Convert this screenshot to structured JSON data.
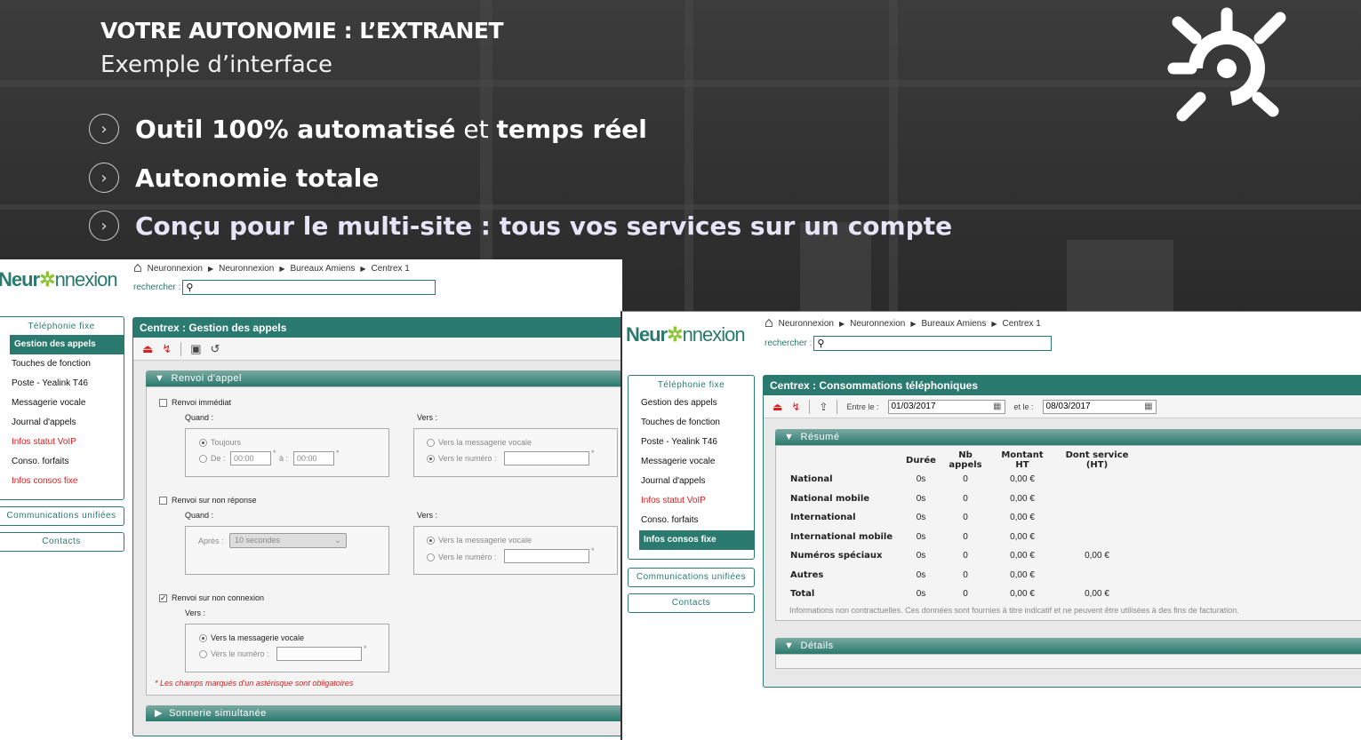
{
  "slide": {
    "title": "VOTRE AUTONOMIE : L’EXTRANET",
    "subtitle": "Exemple d’interface",
    "bullets": [
      {
        "bold1": "Outil 100% automatisé",
        "normal": " et ",
        "bold2": "temps réel"
      },
      {
        "bold1": "Autonomie totale",
        "normal": "",
        "bold2": ""
      },
      {
        "bold1": "Conçu pour le multi-site : tous vos services sur un compte",
        "normal": "",
        "bold2": ""
      }
    ],
    "bullet_icon": "chevron-right-circle-icon",
    "brand_icon": "neuronnexion-sun-icon"
  },
  "colors": {
    "accent": "#2a7a6f",
    "alert": "#d52020",
    "brand_green": "#8fc33a"
  },
  "brand": {
    "part1": "Neur",
    "part2": "nnexion"
  },
  "screen1": {
    "breadcrumb": [
      "Neuronnexion",
      "Neuronnexion",
      "Bureaux Amiens",
      "Centrex 1"
    ],
    "search_label": "rechercher :",
    "logout": "deconnexion",
    "sidebar_title": "Téléphonie fixe",
    "sidebar_items": [
      "Gestion des appels",
      "Touches de fonction",
      "Poste - Yealink T46",
      "Messagerie vocale",
      "Journal d'appels",
      "Infos statut VoIP",
      "Conso. forfaits",
      "Infos consos fixe"
    ],
    "btn_comm": "Communications unifiées",
    "btn_contacts": "Contacts",
    "panel_title": "Centrex : Gestion des appels",
    "sec_renvoi": "Renvoi d'appel",
    "renvoi_immediat": "Renvoi immédiat",
    "quand": "Quand :",
    "vers": "Vers :",
    "toujours": "Toujours",
    "de": "De :",
    "a": "à :",
    "time1": "00:00",
    "time2": "00:00",
    "vers_messagerie": "Vers la messagerie vocale",
    "vers_numero": "Vers le numéro :",
    "renvoi_non_reponse": "Renvoi sur non réponse",
    "apres": "Après :",
    "apres_value": "10 secondes",
    "renvoi_non_connexion": "Renvoi sur non connexion",
    "required_note": "* Les champs marqués d'un astérisque sont obligatoires",
    "star": "*",
    "sec_sonnerie": "Sonnerie simultanée"
  },
  "screen2": {
    "breadcrumb": [
      "Neuronnexion",
      "Neuronnexion",
      "Bureaux Amiens",
      "Centrex 1"
    ],
    "search_label": "rechercher :",
    "sidebar_title": "Téléphonie fixe",
    "sidebar_items": [
      "Gestion des appels",
      "Touches de fonction",
      "Poste - Yealink T46",
      "Messagerie vocale",
      "Journal d'appels",
      "Infos statut VoIP",
      "Conso. forfaits",
      "Infos consos fixe"
    ],
    "btn_comm": "Communications unifiées",
    "btn_contacts": "Contacts",
    "panel_title": "Centrex : Consommations téléphoniques",
    "entre_label": "Entre le :",
    "date_from": "01/03/2017",
    "et_label": "et le :",
    "date_to": "08/03/2017",
    "sec_resume": "Résumé",
    "sec_details": "Détails",
    "table_headers": [
      "",
      "Durée",
      "Nb appels",
      "Montant HT",
      "Dont service (HT)"
    ],
    "table_rows": [
      [
        "National",
        "0s",
        "0",
        "0,00 €",
        ""
      ],
      [
        "National mobile",
        "0s",
        "0",
        "0,00 €",
        ""
      ],
      [
        "International",
        "0s",
        "0",
        "0,00 €",
        ""
      ],
      [
        "International mobile",
        "0s",
        "0",
        "0,00 €",
        ""
      ],
      [
        "Numéros spéciaux",
        "0s",
        "0",
        "0,00 €",
        "0,00 €"
      ],
      [
        "Autres",
        "0s",
        "0",
        "0,00 €",
        ""
      ],
      [
        "Total",
        "0s",
        "0",
        "0,00 €",
        "0,00 €"
      ]
    ],
    "disclaimer": "Informations non contractuelles. Ces données sont fournies à titre indicatif et ne peuvent être utilisées à des fins de facturation."
  }
}
